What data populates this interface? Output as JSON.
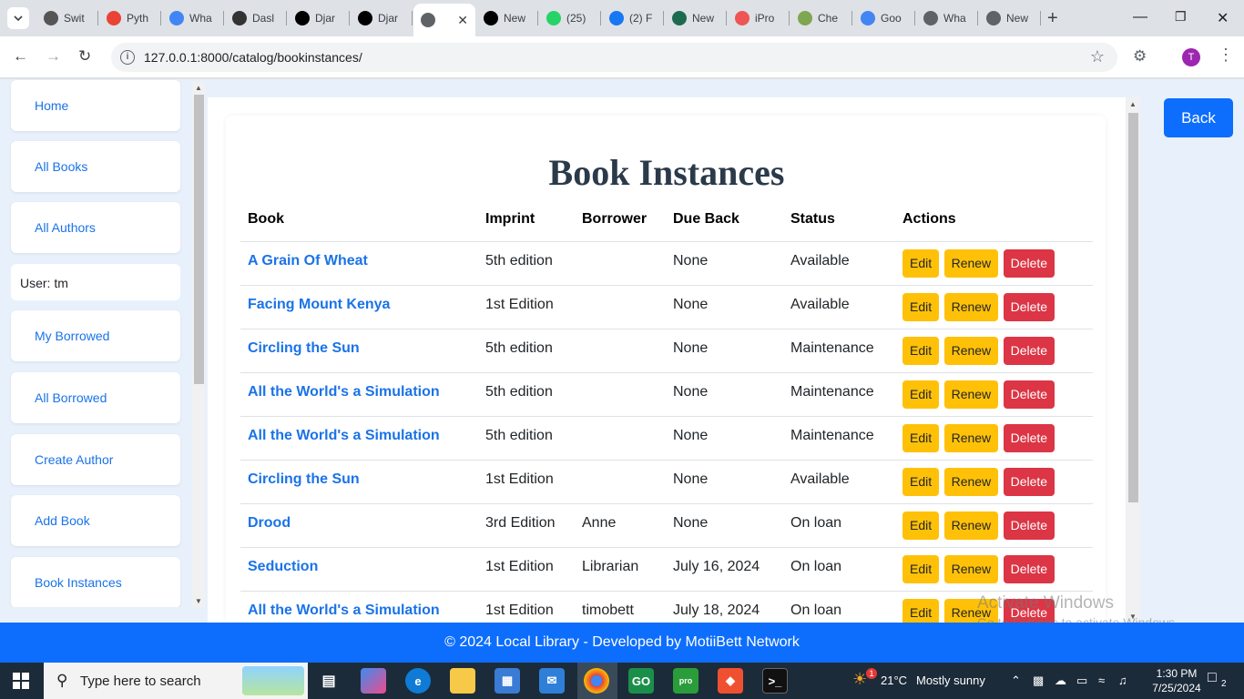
{
  "browser": {
    "tabs": [
      {
        "label": "Swit",
        "icon": "settings-icon",
        "color": "#555"
      },
      {
        "label": "Pyth",
        "icon": "gmail-icon",
        "color": "#ea4335"
      },
      {
        "label": "Wha",
        "icon": "docs-icon",
        "color": "#4285f4"
      },
      {
        "label": "Dasl",
        "icon": "dashboard-icon",
        "color": "#333"
      },
      {
        "label": "Djar",
        "icon": "medium-icon",
        "color": "#000"
      },
      {
        "label": "Djar",
        "icon": "medium-icon",
        "color": "#000"
      },
      {
        "label": "",
        "icon": "globe-icon",
        "color": "#5f6368",
        "active": true
      },
      {
        "label": "New",
        "icon": "github-icon",
        "color": "#000"
      },
      {
        "label": "(25)",
        "icon": "whatsapp-icon",
        "color": "#25d366",
        "badge": "25"
      },
      {
        "label": "(2) F",
        "icon": "facebook-icon",
        "color": "#1877f2"
      },
      {
        "label": "New",
        "icon": "chat-icon",
        "color": "#1d6b4f"
      },
      {
        "label": "iPro",
        "icon": "iprofile-icon",
        "color": "#e55"
      },
      {
        "label": "Che",
        "icon": "chess-icon",
        "color": "#7fa650"
      },
      {
        "label": "Goo",
        "icon": "google-icon",
        "color": "#4285f4"
      },
      {
        "label": "Wha",
        "icon": "globe-icon",
        "color": "#5f6368"
      },
      {
        "label": "New",
        "icon": "chrome-icon",
        "color": "#5f6368"
      }
    ],
    "url": "127.0.0.1:8000/catalog/bookinstances/",
    "profile_initial": "T"
  },
  "sidebar": {
    "items": [
      {
        "label": "Home"
      },
      {
        "label": "All Books"
      },
      {
        "label": "All Authors"
      },
      {
        "label": "My Borrowed"
      },
      {
        "label": "All Borrowed"
      },
      {
        "label": "Create Author"
      },
      {
        "label": "Add Book"
      },
      {
        "label": "Book Instances"
      }
    ],
    "user": "User: tm"
  },
  "page": {
    "title": "Book Instances",
    "back_label": "Back"
  },
  "table": {
    "headers": [
      "Book",
      "Imprint",
      "Borrower",
      "Due Back",
      "Status",
      "Actions"
    ],
    "rows": [
      {
        "book": "A Grain Of Wheat",
        "imprint": "5th edition",
        "borrower": "",
        "due": "None",
        "status": "Available"
      },
      {
        "book": "Facing Mount Kenya",
        "imprint": "1st Edition",
        "borrower": "",
        "due": "None",
        "status": "Available"
      },
      {
        "book": "Circling the Sun",
        "imprint": "5th edition",
        "borrower": "",
        "due": "None",
        "status": "Maintenance"
      },
      {
        "book": "All the World's a Simulation",
        "imprint": "5th edition",
        "borrower": "",
        "due": "None",
        "status": "Maintenance"
      },
      {
        "book": "All the World's a Simulation",
        "imprint": "5th edition",
        "borrower": "",
        "due": "None",
        "status": "Maintenance"
      },
      {
        "book": "Circling the Sun",
        "imprint": "1st Edition",
        "borrower": "",
        "due": "None",
        "status": "Available"
      },
      {
        "book": "Drood",
        "imprint": "3rd Edition",
        "borrower": "Anne",
        "due": "None",
        "status": "On loan"
      },
      {
        "book": "Seduction",
        "imprint": "1st Edition",
        "borrower": "Librarian",
        "due": "July 16, 2024",
        "status": "On loan"
      },
      {
        "book": "All the World's a Simulation",
        "imprint": "1st Edition",
        "borrower": "timobett",
        "due": "July 18, 2024",
        "status": "On loan"
      }
    ],
    "actions": {
      "edit": "Edit",
      "renew": "Renew",
      "delete": "Delete"
    }
  },
  "watermark": {
    "line1": "Activate Windows",
    "line2": "Go to Settings to activate Windows."
  },
  "footer": "© 2024 Local Library - Developed by MotiiBett Network",
  "taskbar": {
    "search_placeholder": "Type here to search",
    "weather_temp": "21°C",
    "weather_desc": "Mostly sunny",
    "time": "1:30 PM",
    "date": "7/25/2024",
    "notifications": "2",
    "weather_badge": "1"
  },
  "colors": {
    "link": "#1a73e8",
    "primary": "#0d6efd",
    "warning": "#ffc107",
    "danger": "#dc3545"
  }
}
